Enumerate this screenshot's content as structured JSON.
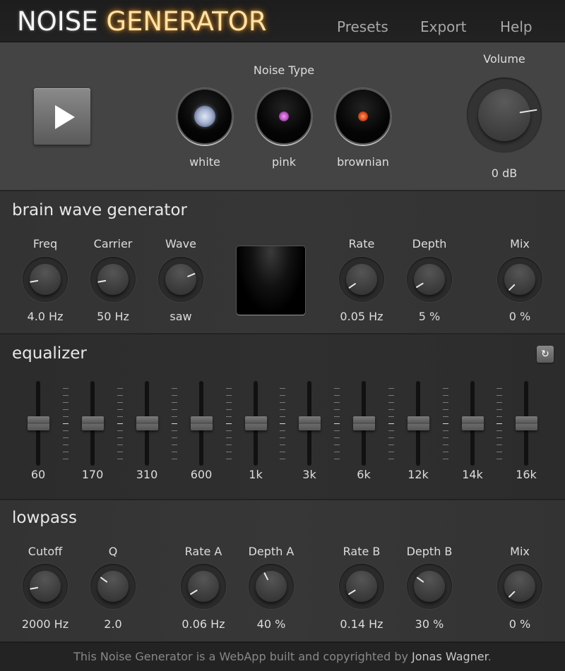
{
  "header": {
    "title_part1": "NOISE",
    "title_part2": "GENERATOR",
    "nav": [
      "Presets",
      "Export",
      "Help"
    ]
  },
  "generator": {
    "play_icon": "play-icon",
    "noise_type_label": "Noise Type",
    "noise_types": [
      {
        "label": "white",
        "color": "#b6c0dc"
      },
      {
        "label": "pink",
        "color": "#c25ccb"
      },
      {
        "label": "brownian",
        "color": "#e0531f"
      }
    ],
    "volume": {
      "label": "Volume",
      "value": "0 dB",
      "position": 0.8
    }
  },
  "brainwave": {
    "title": "brain wave generator",
    "knobs": [
      {
        "label": "Freq",
        "value": "4.0 Hz",
        "position": 0.13
      },
      {
        "label": "Carrier",
        "value": "50 Hz",
        "position": 0.13
      },
      {
        "label": "Wave",
        "value": "saw",
        "position": 0.75
      },
      {
        "label": "Rate",
        "value": "0.05 Hz",
        "position": 0.04
      },
      {
        "label": "Depth",
        "value": "5 %",
        "position": 0.05
      },
      {
        "label": "Mix",
        "value": "0 %",
        "position": 0.0
      }
    ]
  },
  "equalizer": {
    "title": "equalizer",
    "reset_icon": "reset-icon",
    "bands": [
      {
        "label": "60",
        "gain_db": 0
      },
      {
        "label": "170",
        "gain_db": 0
      },
      {
        "label": "310",
        "gain_db": 0
      },
      {
        "label": "600",
        "gain_db": 0
      },
      {
        "label": "1k",
        "gain_db": 0
      },
      {
        "label": "3k",
        "gain_db": 0
      },
      {
        "label": "6k",
        "gain_db": 0
      },
      {
        "label": "12k",
        "gain_db": 0
      },
      {
        "label": "14k",
        "gain_db": 0
      },
      {
        "label": "16k",
        "gain_db": 0
      }
    ]
  },
  "lowpass": {
    "title": "lowpass",
    "knobs": [
      {
        "label": "Cutoff",
        "value": "2000 Hz",
        "position": 0.13
      },
      {
        "label": "Q",
        "value": "2.0",
        "position": 0.3
      },
      {
        "label": "Rate A",
        "value": "0.06 Hz",
        "position": 0.05
      },
      {
        "label": "Depth A",
        "value": "40 %",
        "position": 0.4
      },
      {
        "label": "Rate B",
        "value": "0.14 Hz",
        "position": 0.05
      },
      {
        "label": "Depth B",
        "value": "30 %",
        "position": 0.3
      },
      {
        "label": "Mix",
        "value": "0 %",
        "position": 0.0
      }
    ]
  },
  "footer": {
    "text": "This Noise Generator is a WebApp built and copyrighted by ",
    "author": "Jonas Wagner",
    "suffix": "."
  }
}
